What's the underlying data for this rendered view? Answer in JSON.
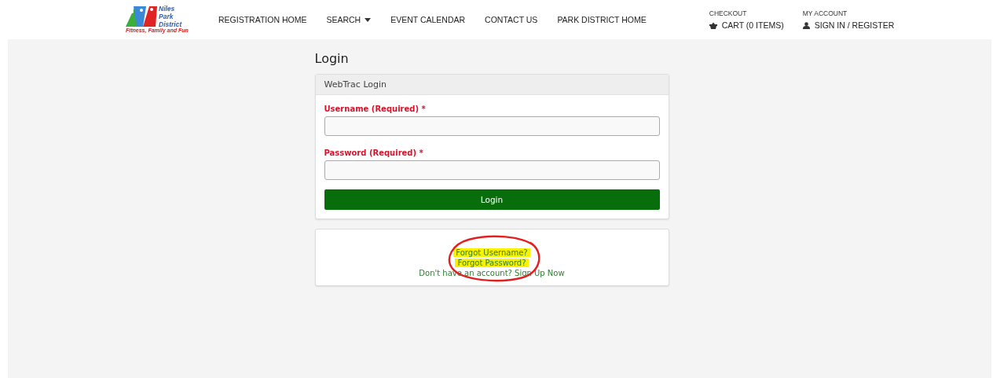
{
  "logo": {
    "name_lines": [
      "Niles",
      "Park",
      "District"
    ],
    "tagline": "Fitness, Family and Fun"
  },
  "nav": [
    {
      "label": "REGISTRATION HOME",
      "dropdown": false
    },
    {
      "label": "SEARCH",
      "dropdown": true
    },
    {
      "label": "EVENT CALENDAR",
      "dropdown": false
    },
    {
      "label": "CONTACT US",
      "dropdown": false
    },
    {
      "label": "PARK DISTRICT HOME",
      "dropdown": false
    }
  ],
  "account_links": [
    {
      "kind": "cart",
      "caption": "CHECKOUT",
      "label": "CART (0 ITEMS)"
    },
    {
      "kind": "user",
      "caption": "MY ACCOUNT",
      "label": "SIGN IN / REGISTER"
    }
  ],
  "page_title": "Login",
  "login_panel": {
    "title": "WebTrac Login",
    "fields": [
      {
        "label": "Username (Required) *"
      },
      {
        "label": "Password (Required) *"
      }
    ],
    "button": "Login"
  },
  "help_panel": {
    "annotation_circle": true
  },
  "help_links": [
    {
      "label": "Forgot Username?",
      "highlighted": true
    },
    {
      "label": "Forgot Password?",
      "highlighted": true
    },
    {
      "label": "Don't have an account? Sign Up Now",
      "highlighted": false
    }
  ]
}
